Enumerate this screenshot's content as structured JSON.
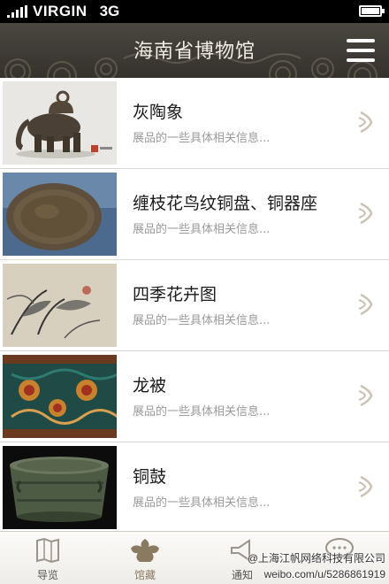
{
  "status_bar": {
    "carrier": "VIRGIN",
    "network": "3G"
  },
  "header": {
    "title": "海南省博物馆"
  },
  "items": [
    {
      "title": "灰陶象",
      "desc": "展品的一些具体相关信息..."
    },
    {
      "title": "缠枝花鸟纹铜盘、铜器座",
      "desc": "展品的一些具体相关信息..."
    },
    {
      "title": "四季花卉图",
      "desc": "展品的一些具体相关信息..."
    },
    {
      "title": "龙被",
      "desc": "展品的一些具体相关信息..."
    },
    {
      "title": "铜鼓",
      "desc": "展品的一些具体相关信息..."
    }
  ],
  "tabs": [
    {
      "label": "导览",
      "icon": "map-icon"
    },
    {
      "label": "馆藏",
      "icon": "collection-icon",
      "active": true
    },
    {
      "label": "通知",
      "icon": "notice-icon"
    },
    {
      "label": "",
      "icon": "chat-icon"
    }
  ],
  "watermark": {
    "line1": "@上海江帆网络科技有限公司",
    "line2": "weibo.com/u/5286861919"
  },
  "colors": {
    "header": "#3d3a34",
    "active_tab": "#8a7a62",
    "desc": "#9a9a9a"
  }
}
